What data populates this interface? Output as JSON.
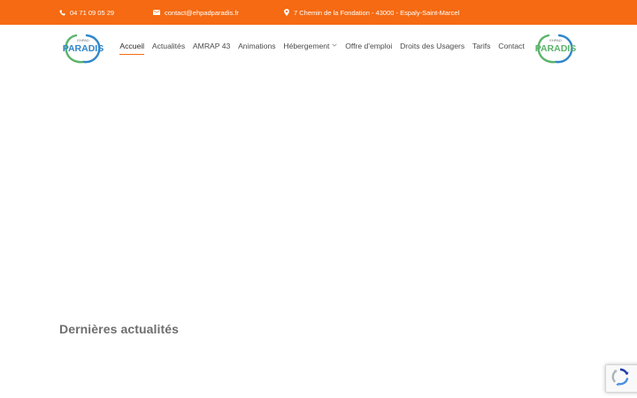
{
  "topbar": {
    "phone": "04 71 09 05 29",
    "email": "contact@ehpadparadis.fr",
    "address": "7 Chemin de la Fondation - 43000 - Espaly-Saint-Marcel",
    "background_color": "#f56a12"
  },
  "logo": {
    "small_text": "EHPAD",
    "brand_text": "PARADIS"
  },
  "nav": {
    "items": [
      {
        "label": "Accueil",
        "active": true
      },
      {
        "label": "Actualités"
      },
      {
        "label": "AMRAP 43"
      },
      {
        "label": "Animations"
      },
      {
        "label": "Hébergement",
        "has_dropdown": true
      },
      {
        "label": "Offre d'emploi"
      },
      {
        "label": "Droits des Usagers"
      },
      {
        "label": "Tarifs"
      },
      {
        "label": "Contact"
      }
    ],
    "accent_color": "#f56a12"
  },
  "main": {
    "section_title": "Dernières actualités"
  },
  "icons": {
    "phone": "phone-icon",
    "email": "envelope-icon",
    "address": "map-pin-icon",
    "dropdown": "chevron-down-icon",
    "recaptcha": "recaptcha-icon"
  }
}
